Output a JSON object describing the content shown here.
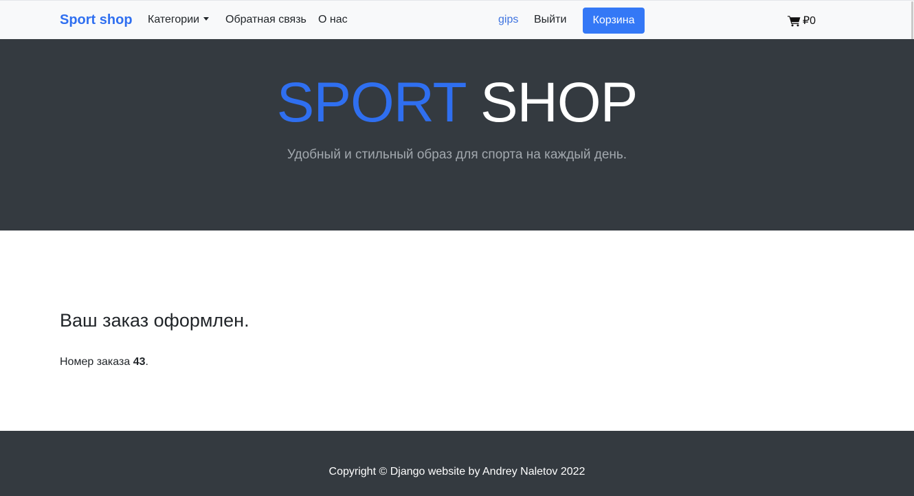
{
  "navbar": {
    "brand": "Sport shop",
    "categories_label": "Категории",
    "feedback_label": "Обратная связь",
    "about_label": "О нас",
    "username": "gips",
    "logout_label": "Выйти",
    "cart_button_label": "Корзина",
    "cart_icon": "shopping-cart-icon",
    "cart_total": "₽0"
  },
  "hero": {
    "title_part1": "SPORT",
    "title_part2": "SHOP",
    "subtitle": "Удобный и стильный образ для спорта на каждый день."
  },
  "main": {
    "heading": "Ваш заказ оформлен.",
    "order_prefix": "Номер заказа",
    "order_number": "43",
    "order_suffix": "."
  },
  "footer": {
    "copyright": "Copyright © Django website by Andrey Naletov 2022"
  },
  "colors": {
    "brand": "#2f6ff0",
    "button": "#3478f6",
    "dark": "#343a40",
    "navbar_bg": "#f8f9fa"
  }
}
